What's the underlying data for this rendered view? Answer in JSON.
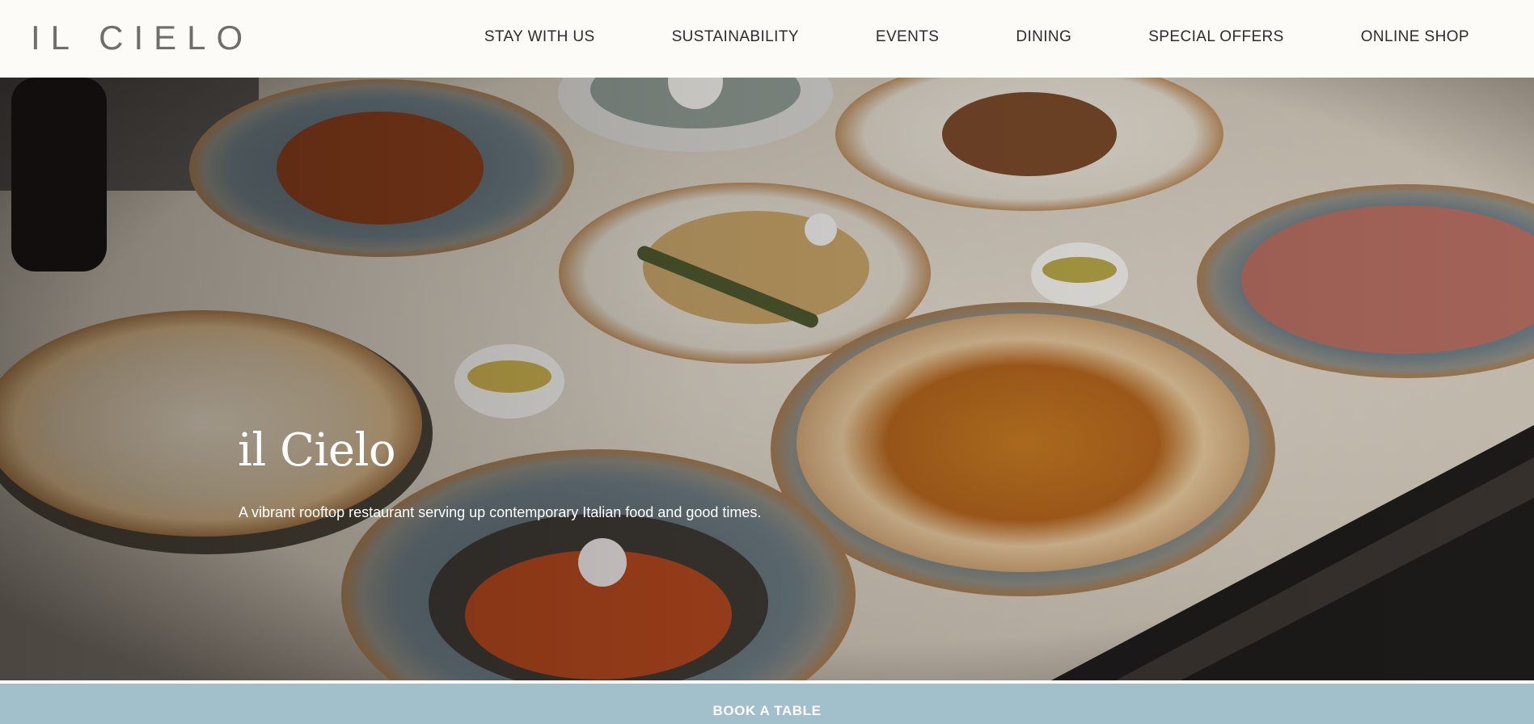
{
  "header": {
    "logo": "IL CIELO",
    "nav": [
      "STAY WITH US",
      "SUSTAINABILITY",
      "EVENTS",
      "DINING",
      "SPECIAL OFFERS",
      "ONLINE SHOP"
    ]
  },
  "hero": {
    "title": "il Cielo",
    "subtitle": "A vibrant rooftop restaurant serving up contemporary Italian food and good times."
  },
  "cta": {
    "book_label": "BOOK A TABLE"
  },
  "colors": {
    "header_bg": "#fcfbf7",
    "cta_bg": "#a2bfcc",
    "logo": "#6e6e6a"
  }
}
